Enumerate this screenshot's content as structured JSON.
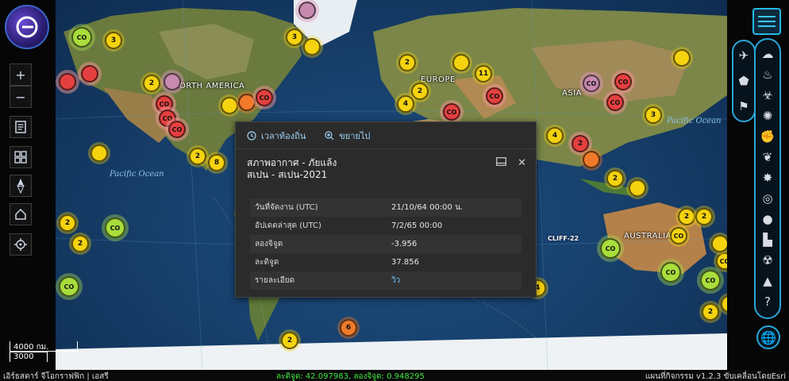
{
  "map": {
    "continents": [
      "NORTH AMERICA",
      "EUROPE",
      "ASIA",
      "AUSTRALIA"
    ],
    "oceans": [
      "Pacific Ocean",
      "Pacific Ocean"
    ],
    "clusters": {
      "c3a": "3",
      "c2a": "2",
      "c2b": "2",
      "c3b": "3",
      "c2c": "2",
      "c3c": "3",
      "c2d": "2",
      "c11": "11",
      "c2e": "2",
      "c4a": "4",
      "c2f": "2",
      "c4b": "4",
      "c3d": "3",
      "c2g": "2",
      "c8": "8",
      "c2h": "2",
      "c6": "6",
      "c2i": "2",
      "c2j": "2",
      "c2k": "2",
      "c3e": "3",
      "c4c": "4",
      "c2l": "2"
    },
    "co_label": "CO",
    "point_tag": "CLIFF-22"
  },
  "popup": {
    "actions": [
      "เวลาท้องถิ่น",
      "ขยายไป"
    ],
    "title_line1": "สภาพอากาศ - ภัยแล้ง",
    "title_line2": "สเปน - สเปน-2021",
    "rows": [
      {
        "label": "วันที่จัดงาน (UTC)",
        "value": "21/10/64 00:00 น."
      },
      {
        "label": "อัปเดตล่าสุด (UTC)",
        "value": "7/2/65 00:00"
      },
      {
        "label": "ลองจิจูด",
        "value": "-3.956"
      },
      {
        "label": "ละติจูด",
        "value": "37.856"
      },
      {
        "label": "รายละเอียด",
        "value": "วิว"
      }
    ]
  },
  "scale": {
    "top": "4000 กม.",
    "bottom": "3000"
  },
  "footer": {
    "attribution": "เอิร์ธสตาร์ จีโอกราฟฟิก | เอสรี",
    "coords": "ละติจูด: 42.097983, ลองจิจูด: 0.948295",
    "version": "แผนที่กิจกรรม v1.2.3  ขับเคลื่อนโดยEsri"
  },
  "colors": {
    "accent": "#2aa6d8",
    "coords": "#43e643",
    "link": "#6cc3ff"
  }
}
